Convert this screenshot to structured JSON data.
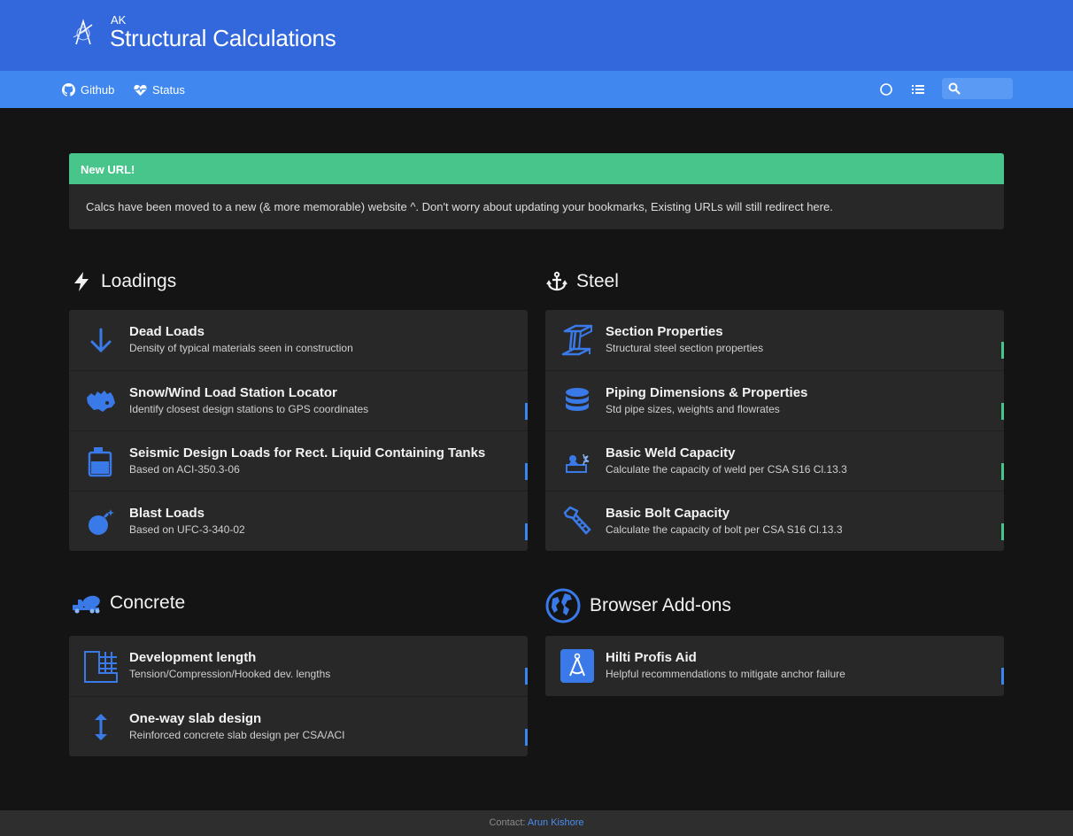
{
  "header": {
    "subtitle": "AK",
    "title": "Structural Calculations"
  },
  "nav": {
    "github": "Github",
    "status": "Status",
    "search_placeholder": ""
  },
  "alert": {
    "title": "New URL!",
    "body": "Calcs have been moved to a new (& more memorable) website ^. Don't worry about updating your bookmarks, Existing URLs will still redirect here."
  },
  "sections": {
    "loadings": {
      "title": "Loadings",
      "items": [
        {
          "title": "Dead Loads",
          "desc": "Density of typical materials seen in construction"
        },
        {
          "title": "Snow/Wind Load Station Locator",
          "desc": "Identify closest design stations to GPS coordinates"
        },
        {
          "title": "Seismic Design Loads for Rect. Liquid Containing Tanks",
          "desc": "Based on ACI-350.3-06"
        },
        {
          "title": "Blast Loads",
          "desc": "Based on UFC-3-340-02"
        }
      ]
    },
    "steel": {
      "title": "Steel",
      "items": [
        {
          "title": "Section Properties",
          "desc": "Structural steel section properties"
        },
        {
          "title": "Piping Dimensions & Properties",
          "desc": "Std pipe sizes, weights and flowrates"
        },
        {
          "title": "Basic Weld Capacity",
          "desc": "Calculate the capacity of weld per CSA S16 Cl.13.3"
        },
        {
          "title": "Basic Bolt Capacity",
          "desc": "Calculate the capacity of bolt per CSA S16 Cl.13.3"
        }
      ]
    },
    "concrete": {
      "title": "Concrete",
      "items": [
        {
          "title": "Development length",
          "desc": "Tension/Compression/Hooked dev. lengths"
        },
        {
          "title": "One-way slab design",
          "desc": "Reinforced concrete slab design per CSA/ACI"
        }
      ]
    },
    "addons": {
      "title": "Browser Add-ons",
      "items": [
        {
          "title": "Hilti Profis Aid",
          "desc": "Helpful recommendations to mitigate anchor failure"
        }
      ]
    }
  },
  "footer": {
    "label": "Contact:",
    "contact_name": "Arun Kishore"
  },
  "colors": {
    "header": "#3268dc",
    "navbar": "#4088f0",
    "alert_head": "#48c58a",
    "accent": "#3a86f0",
    "background": "#141414",
    "card": "#282828"
  }
}
